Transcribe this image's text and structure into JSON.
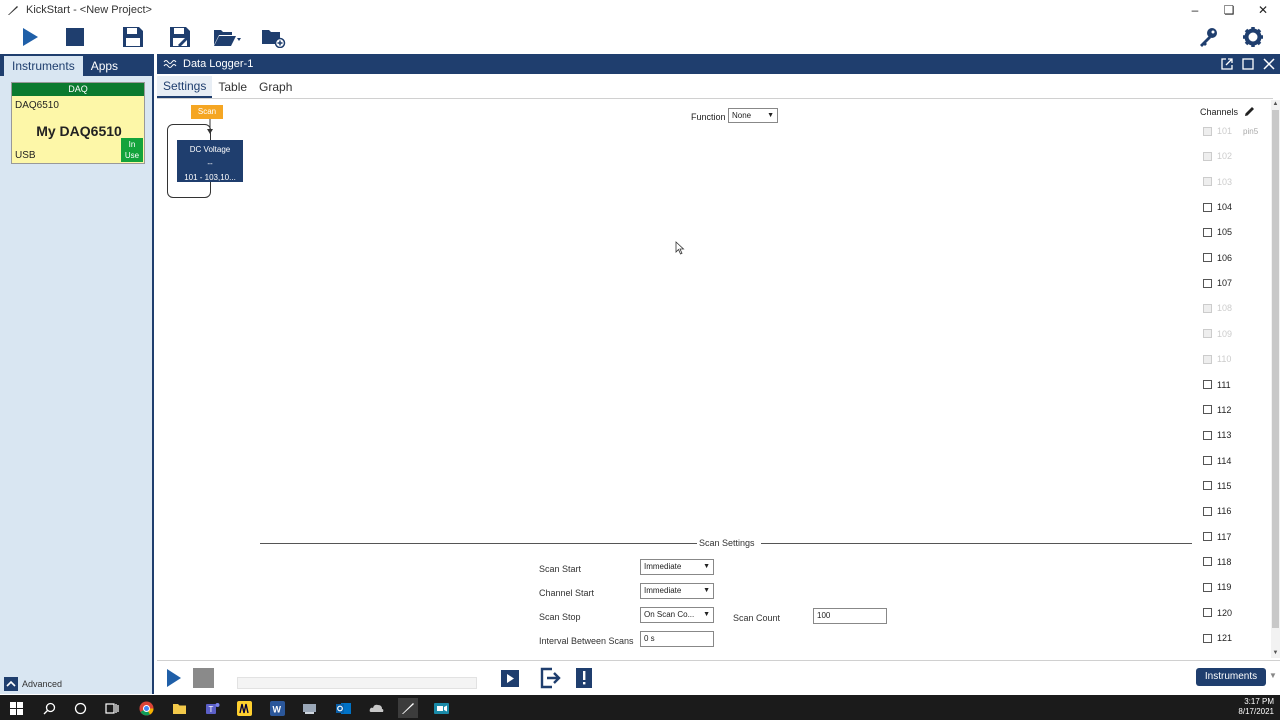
{
  "window": {
    "title": "KickStart - <New Project>"
  },
  "left_panel": {
    "tabs": [
      {
        "label": "Instruments"
      },
      {
        "label": "Apps"
      }
    ],
    "instrument_card": {
      "header": "DAQ",
      "model": "DAQ6510",
      "name": "My DAQ6510",
      "connection": "USB",
      "status": "In Use"
    },
    "advanced_label": "Advanced"
  },
  "main": {
    "title": "Data Logger-1",
    "tabs": [
      {
        "label": "Settings"
      },
      {
        "label": "Table"
      },
      {
        "label": "Graph"
      }
    ],
    "scan_tag": "Scan",
    "block": {
      "line1": "DC Voltage",
      "line2": "--",
      "line3": "101 - 103,10..."
    },
    "function": {
      "label": "Function",
      "value": "None"
    },
    "scan_settings": {
      "title": "Scan Settings",
      "scan_start": {
        "label": "Scan Start",
        "value": "Immediate"
      },
      "channel_start": {
        "label": "Channel Start",
        "value": "Immediate"
      },
      "scan_stop": {
        "label": "Scan Stop",
        "value": "On Scan Co..."
      },
      "scan_count": {
        "label": "Scan Count",
        "value": "100"
      },
      "interval": {
        "label": "Interval Between Scans",
        "value": "0 s"
      }
    },
    "channels": {
      "title": "Channels",
      "items": [
        {
          "id": "101",
          "alias": "pin5",
          "enabled": false
        },
        {
          "id": "102",
          "alias": "",
          "enabled": false
        },
        {
          "id": "103",
          "alias": "",
          "enabled": false
        },
        {
          "id": "104",
          "alias": "",
          "enabled": true
        },
        {
          "id": "105",
          "alias": "",
          "enabled": true
        },
        {
          "id": "106",
          "alias": "",
          "enabled": true
        },
        {
          "id": "107",
          "alias": "",
          "enabled": true
        },
        {
          "id": "108",
          "alias": "",
          "enabled": false
        },
        {
          "id": "109",
          "alias": "",
          "enabled": false
        },
        {
          "id": "110",
          "alias": "",
          "enabled": false
        },
        {
          "id": "111",
          "alias": "",
          "enabled": true
        },
        {
          "id": "112",
          "alias": "",
          "enabled": true
        },
        {
          "id": "113",
          "alias": "",
          "enabled": true
        },
        {
          "id": "114",
          "alias": "",
          "enabled": true
        },
        {
          "id": "115",
          "alias": "",
          "enabled": true
        },
        {
          "id": "116",
          "alias": "",
          "enabled": true
        },
        {
          "id": "117",
          "alias": "",
          "enabled": true
        },
        {
          "id": "118",
          "alias": "",
          "enabled": true
        },
        {
          "id": "119",
          "alias": "",
          "enabled": true
        },
        {
          "id": "120",
          "alias": "",
          "enabled": true
        },
        {
          "id": "121",
          "alias": "",
          "enabled": true
        }
      ]
    }
  },
  "bottom_bar": {
    "instruments_button": "Instruments"
  },
  "taskbar": {
    "time": "3:17 PM",
    "date": "8/17/2021"
  },
  "colors": {
    "navy": "#1f3e6e",
    "daq_green": "#0b7a2f",
    "in_use_green": "#13a33b",
    "card_yellow": "#fdf7a8",
    "scan_orange": "#f5a623"
  }
}
